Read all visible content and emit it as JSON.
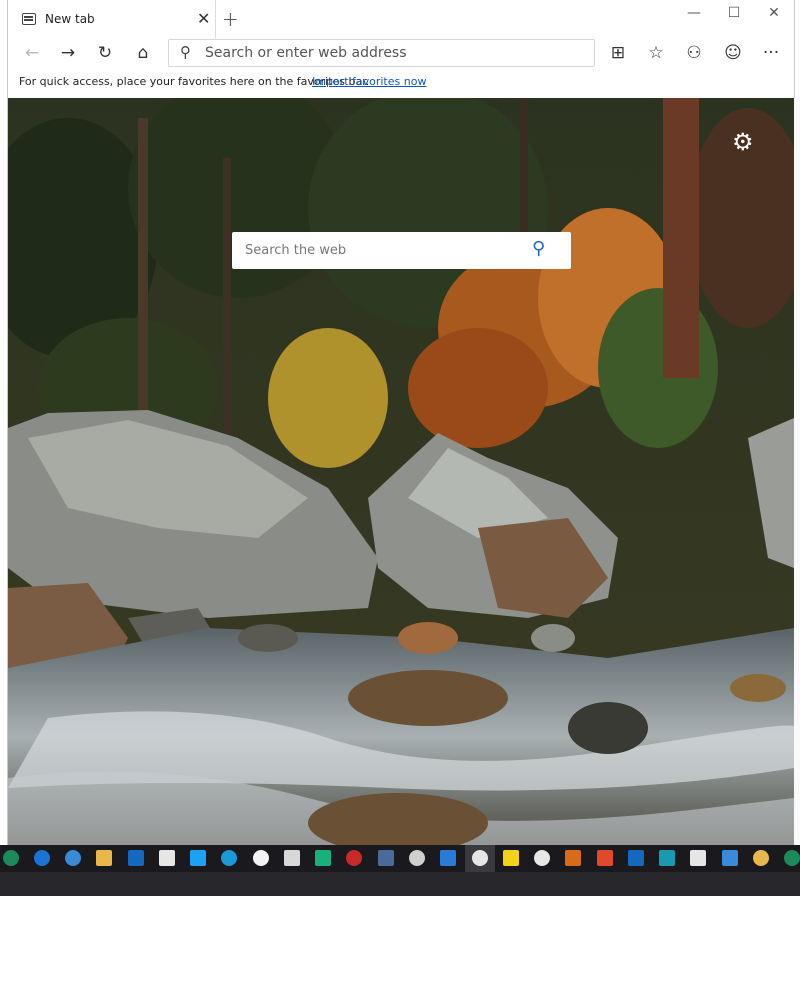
{
  "tab": {
    "title": "New tab",
    "close": "✕"
  },
  "newtab": "+",
  "window_controls": {
    "minimize": "—",
    "maximize": "☐",
    "close": "✕"
  },
  "toolbar": {
    "back": "←",
    "forward": "→",
    "refresh": "↻",
    "home": "⌂",
    "address_placeholder": "Search or enter web address",
    "search_icon": "⚲",
    "reading_view": "⊞",
    "favorites": "☆",
    "profile": "⚇",
    "feedback": "☺",
    "more": "···"
  },
  "favbar": {
    "message": "For quick access, place your favorites here on the favorites bar.",
    "link": "Import favorites now"
  },
  "content": {
    "settings_icon": "⚙",
    "search_placeholder": "Search the web",
    "search_icon": "⚲"
  },
  "colors": {
    "link": "#0b57c5",
    "search_icon": "#1668c9",
    "taskbar": "#1a1a1e"
  }
}
